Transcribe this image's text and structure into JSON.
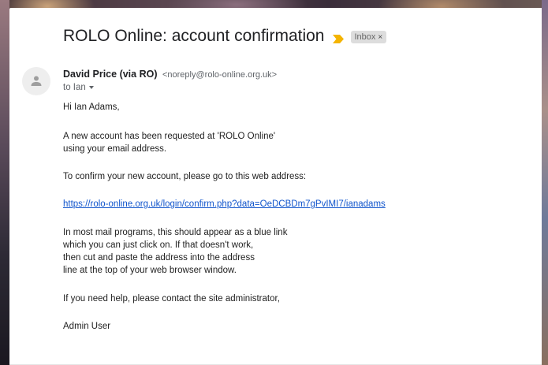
{
  "email": {
    "subject": "ROLO Online: account confirmation",
    "label_chip": "Inbox",
    "label_chip_close": "×",
    "sender_name": "David Price (via RO)",
    "sender_email": "<noreply@rolo-online.org.uk>",
    "to_line": "to Ian",
    "body": {
      "greeting": "Hi Ian Adams,",
      "para1_line1": "A new account has been requested at 'ROLO Online'",
      "para1_line2": "using your email address.",
      "para2": "To confirm your new account, please go to this web address:",
      "link": "https://rolo-online.org.uk/login/confirm.php?data=OeDCBDm7gPvIMI7/ianadams",
      "para3_line1": "In most mail programs, this should appear as a blue link",
      "para3_line2": "which you can just click on. If that doesn't work,",
      "para3_line3": "then cut and paste the address into the address",
      "para3_line4": "line at the top of your web browser window.",
      "para4": "If you need help, please contact the site administrator,",
      "signature": "Admin User"
    }
  },
  "icons": {
    "important": "important-marker-icon",
    "avatar": "person-avatar-icon",
    "dropdown": "chevron-down-icon"
  },
  "colors": {
    "important_marker": "#f4b400",
    "link": "#1155cc",
    "chip_bg": "#dddddd"
  }
}
